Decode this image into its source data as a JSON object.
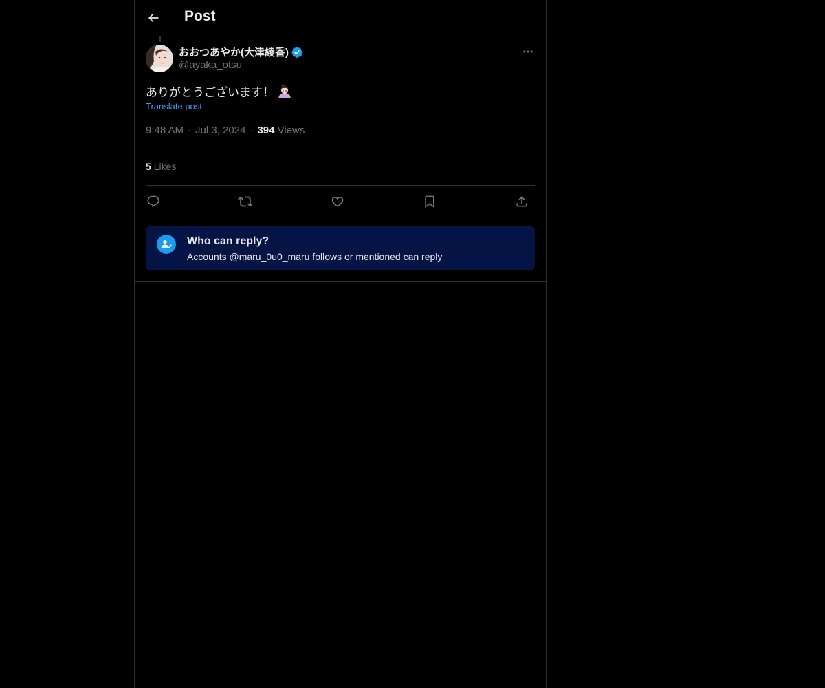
{
  "header": {
    "back_icon": "arrow-left-icon",
    "title": "Post"
  },
  "tweet": {
    "author": {
      "display_name": "おおつあやか(大津綾香)",
      "handle": "@ayaka_otsu",
      "verified": true,
      "verified_color": "#1d9bf0"
    },
    "text": "ありがとうございます！",
    "emoji_icon": "person-bowing-emoji",
    "translate_label": "Translate post",
    "time": "9:48 AM",
    "date": "Jul 3, 2024",
    "separator": "·",
    "views_count": "394",
    "views_label": "Views",
    "likes_count": "5",
    "likes_label": "Likes"
  },
  "actions": [
    {
      "name": "reply",
      "icon": "reply-icon"
    },
    {
      "name": "repost",
      "icon": "repost-icon"
    },
    {
      "name": "like",
      "icon": "heart-icon"
    },
    {
      "name": "bookmark",
      "icon": "bookmark-icon"
    },
    {
      "name": "share",
      "icon": "share-icon"
    }
  ],
  "reply_restriction": {
    "icon": "person-check-icon",
    "title": "Who can reply?",
    "description": "Accounts @maru_0u0_maru follows or mentioned can reply"
  },
  "colors": {
    "background": "#000000",
    "text_primary": "#e7e9ea",
    "text_secondary": "#71767b",
    "accent": "#1d9bf0",
    "link": "#4a93e8",
    "reply_box_bg": "#031445",
    "border": "#2f3336"
  }
}
